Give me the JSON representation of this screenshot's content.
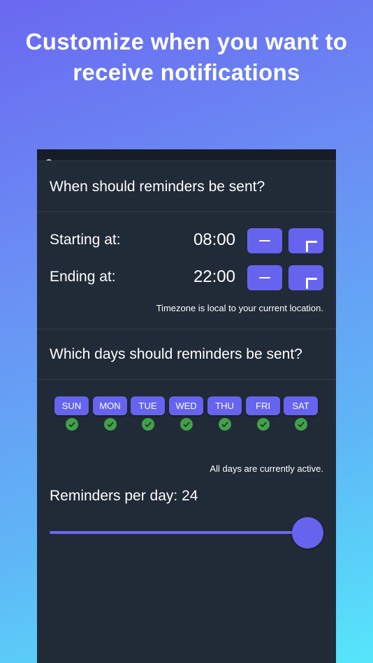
{
  "headline": "Customize when you want to receive notifications",
  "sections": {
    "time_question": "When should reminders be sent?",
    "days_question": "Which days should reminders be sent?"
  },
  "start": {
    "label": "Starting at:",
    "value": "08:00"
  },
  "end": {
    "label": "Ending at:",
    "value": "22:00"
  },
  "timezone_note": "Timezone is local to your current location.",
  "days": [
    {
      "label": "SUN",
      "active": true
    },
    {
      "label": "MON",
      "active": true
    },
    {
      "label": "TUE",
      "active": true
    },
    {
      "label": "WED",
      "active": true
    },
    {
      "label": "THU",
      "active": true
    },
    {
      "label": "FRI",
      "active": true
    },
    {
      "label": "SAT",
      "active": true
    }
  ],
  "days_note": "All days are currently active.",
  "reminders": {
    "label": "Reminders per day:",
    "value": "24",
    "slider_fraction": 1.0
  },
  "colors": {
    "accent": "#6664ee",
    "check": "#41a14a",
    "panel": "#212a37"
  },
  "icons": {
    "minus": "minus-icon",
    "plus": "plus-icon",
    "check": "check-icon"
  }
}
